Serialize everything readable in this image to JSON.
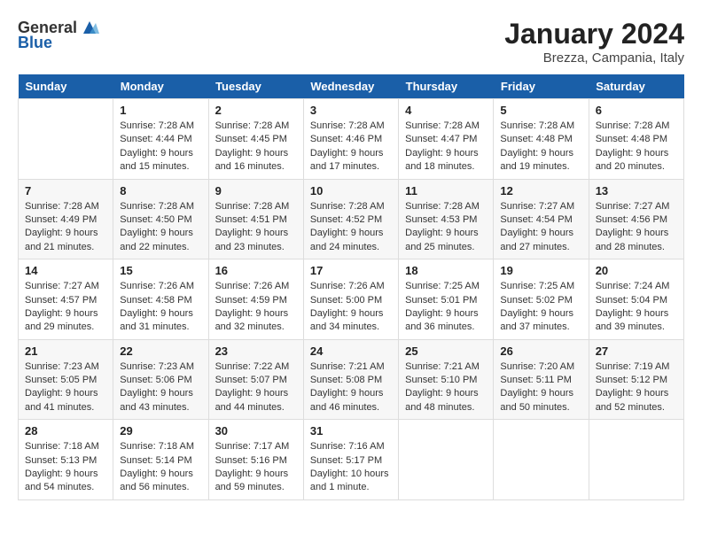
{
  "header": {
    "logo_general": "General",
    "logo_blue": "Blue",
    "month_year": "January 2024",
    "location": "Brezza, Campania, Italy"
  },
  "weekdays": [
    "Sunday",
    "Monday",
    "Tuesday",
    "Wednesday",
    "Thursday",
    "Friday",
    "Saturday"
  ],
  "weeks": [
    [
      {
        "day": "",
        "sunrise": "",
        "sunset": "",
        "daylight": ""
      },
      {
        "day": "1",
        "sunrise": "Sunrise: 7:28 AM",
        "sunset": "Sunset: 4:44 PM",
        "daylight": "Daylight: 9 hours and 15 minutes."
      },
      {
        "day": "2",
        "sunrise": "Sunrise: 7:28 AM",
        "sunset": "Sunset: 4:45 PM",
        "daylight": "Daylight: 9 hours and 16 minutes."
      },
      {
        "day": "3",
        "sunrise": "Sunrise: 7:28 AM",
        "sunset": "Sunset: 4:46 PM",
        "daylight": "Daylight: 9 hours and 17 minutes."
      },
      {
        "day": "4",
        "sunrise": "Sunrise: 7:28 AM",
        "sunset": "Sunset: 4:47 PM",
        "daylight": "Daylight: 9 hours and 18 minutes."
      },
      {
        "day": "5",
        "sunrise": "Sunrise: 7:28 AM",
        "sunset": "Sunset: 4:48 PM",
        "daylight": "Daylight: 9 hours and 19 minutes."
      },
      {
        "day": "6",
        "sunrise": "Sunrise: 7:28 AM",
        "sunset": "Sunset: 4:48 PM",
        "daylight": "Daylight: 9 hours and 20 minutes."
      }
    ],
    [
      {
        "day": "7",
        "sunrise": "Sunrise: 7:28 AM",
        "sunset": "Sunset: 4:49 PM",
        "daylight": "Daylight: 9 hours and 21 minutes."
      },
      {
        "day": "8",
        "sunrise": "Sunrise: 7:28 AM",
        "sunset": "Sunset: 4:50 PM",
        "daylight": "Daylight: 9 hours and 22 minutes."
      },
      {
        "day": "9",
        "sunrise": "Sunrise: 7:28 AM",
        "sunset": "Sunset: 4:51 PM",
        "daylight": "Daylight: 9 hours and 23 minutes."
      },
      {
        "day": "10",
        "sunrise": "Sunrise: 7:28 AM",
        "sunset": "Sunset: 4:52 PM",
        "daylight": "Daylight: 9 hours and 24 minutes."
      },
      {
        "day": "11",
        "sunrise": "Sunrise: 7:28 AM",
        "sunset": "Sunset: 4:53 PM",
        "daylight": "Daylight: 9 hours and 25 minutes."
      },
      {
        "day": "12",
        "sunrise": "Sunrise: 7:27 AM",
        "sunset": "Sunset: 4:54 PM",
        "daylight": "Daylight: 9 hours and 27 minutes."
      },
      {
        "day": "13",
        "sunrise": "Sunrise: 7:27 AM",
        "sunset": "Sunset: 4:56 PM",
        "daylight": "Daylight: 9 hours and 28 minutes."
      }
    ],
    [
      {
        "day": "14",
        "sunrise": "Sunrise: 7:27 AM",
        "sunset": "Sunset: 4:57 PM",
        "daylight": "Daylight: 9 hours and 29 minutes."
      },
      {
        "day": "15",
        "sunrise": "Sunrise: 7:26 AM",
        "sunset": "Sunset: 4:58 PM",
        "daylight": "Daylight: 9 hours and 31 minutes."
      },
      {
        "day": "16",
        "sunrise": "Sunrise: 7:26 AM",
        "sunset": "Sunset: 4:59 PM",
        "daylight": "Daylight: 9 hours and 32 minutes."
      },
      {
        "day": "17",
        "sunrise": "Sunrise: 7:26 AM",
        "sunset": "Sunset: 5:00 PM",
        "daylight": "Daylight: 9 hours and 34 minutes."
      },
      {
        "day": "18",
        "sunrise": "Sunrise: 7:25 AM",
        "sunset": "Sunset: 5:01 PM",
        "daylight": "Daylight: 9 hours and 36 minutes."
      },
      {
        "day": "19",
        "sunrise": "Sunrise: 7:25 AM",
        "sunset": "Sunset: 5:02 PM",
        "daylight": "Daylight: 9 hours and 37 minutes."
      },
      {
        "day": "20",
        "sunrise": "Sunrise: 7:24 AM",
        "sunset": "Sunset: 5:04 PM",
        "daylight": "Daylight: 9 hours and 39 minutes."
      }
    ],
    [
      {
        "day": "21",
        "sunrise": "Sunrise: 7:23 AM",
        "sunset": "Sunset: 5:05 PM",
        "daylight": "Daylight: 9 hours and 41 minutes."
      },
      {
        "day": "22",
        "sunrise": "Sunrise: 7:23 AM",
        "sunset": "Sunset: 5:06 PM",
        "daylight": "Daylight: 9 hours and 43 minutes."
      },
      {
        "day": "23",
        "sunrise": "Sunrise: 7:22 AM",
        "sunset": "Sunset: 5:07 PM",
        "daylight": "Daylight: 9 hours and 44 minutes."
      },
      {
        "day": "24",
        "sunrise": "Sunrise: 7:21 AM",
        "sunset": "Sunset: 5:08 PM",
        "daylight": "Daylight: 9 hours and 46 minutes."
      },
      {
        "day": "25",
        "sunrise": "Sunrise: 7:21 AM",
        "sunset": "Sunset: 5:10 PM",
        "daylight": "Daylight: 9 hours and 48 minutes."
      },
      {
        "day": "26",
        "sunrise": "Sunrise: 7:20 AM",
        "sunset": "Sunset: 5:11 PM",
        "daylight": "Daylight: 9 hours and 50 minutes."
      },
      {
        "day": "27",
        "sunrise": "Sunrise: 7:19 AM",
        "sunset": "Sunset: 5:12 PM",
        "daylight": "Daylight: 9 hours and 52 minutes."
      }
    ],
    [
      {
        "day": "28",
        "sunrise": "Sunrise: 7:18 AM",
        "sunset": "Sunset: 5:13 PM",
        "daylight": "Daylight: 9 hours and 54 minutes."
      },
      {
        "day": "29",
        "sunrise": "Sunrise: 7:18 AM",
        "sunset": "Sunset: 5:14 PM",
        "daylight": "Daylight: 9 hours and 56 minutes."
      },
      {
        "day": "30",
        "sunrise": "Sunrise: 7:17 AM",
        "sunset": "Sunset: 5:16 PM",
        "daylight": "Daylight: 9 hours and 59 minutes."
      },
      {
        "day": "31",
        "sunrise": "Sunrise: 7:16 AM",
        "sunset": "Sunset: 5:17 PM",
        "daylight": "Daylight: 10 hours and 1 minute."
      },
      {
        "day": "",
        "sunrise": "",
        "sunset": "",
        "daylight": ""
      },
      {
        "day": "",
        "sunrise": "",
        "sunset": "",
        "daylight": ""
      },
      {
        "day": "",
        "sunrise": "",
        "sunset": "",
        "daylight": ""
      }
    ]
  ]
}
